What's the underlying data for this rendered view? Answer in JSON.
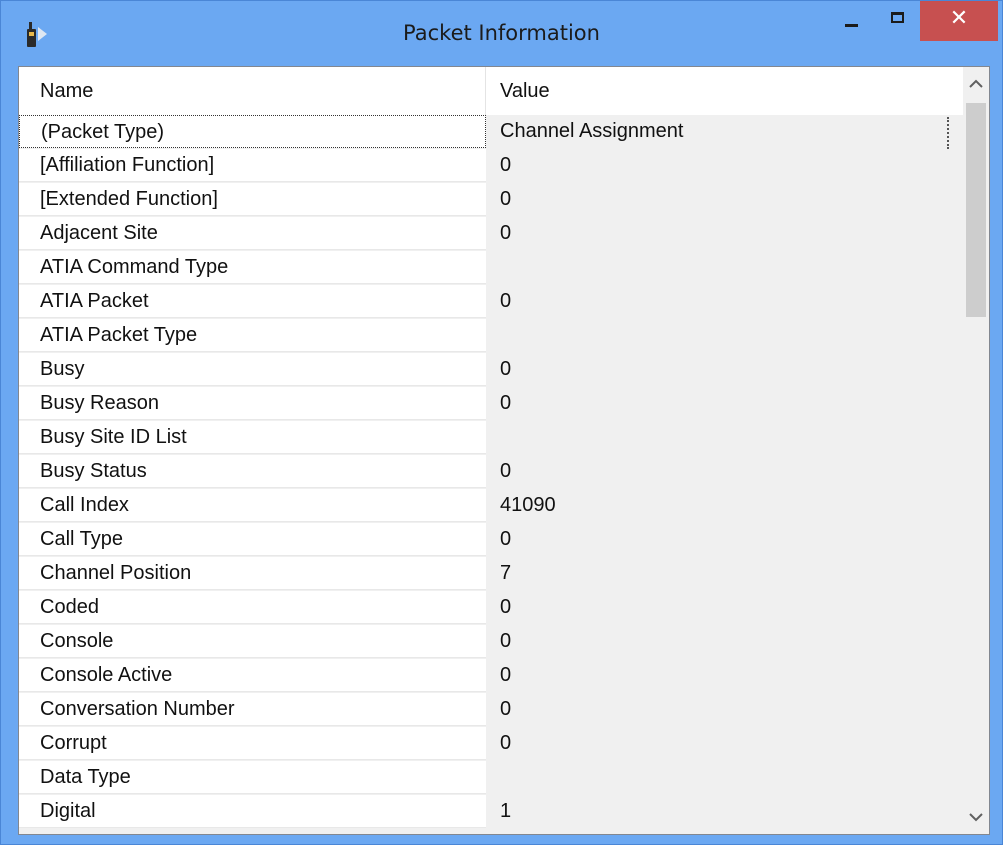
{
  "window": {
    "title": "Packet Information",
    "icon": "radio-icon",
    "controls": {
      "minimize": "minimize-icon",
      "maximize": "maximize-icon",
      "close_glyph": "✕"
    }
  },
  "table": {
    "columns": [
      "Name",
      "Value"
    ],
    "rows": [
      {
        "name": "(Packet Type)",
        "value": "Channel Assignment"
      },
      {
        "name": "[Affiliation Function]",
        "value": "0"
      },
      {
        "name": "[Extended Function]",
        "value": "0"
      },
      {
        "name": "Adjacent Site",
        "value": "0"
      },
      {
        "name": "ATIA Command Type",
        "value": ""
      },
      {
        "name": "ATIA Packet",
        "value": "0"
      },
      {
        "name": "ATIA Packet Type",
        "value": ""
      },
      {
        "name": "Busy",
        "value": "0"
      },
      {
        "name": "Busy Reason",
        "value": "0"
      },
      {
        "name": "Busy Site ID List",
        "value": ""
      },
      {
        "name": "Busy Status",
        "value": "0"
      },
      {
        "name": "Call Index",
        "value": "41090"
      },
      {
        "name": "Call Type",
        "value": "0"
      },
      {
        "name": "Channel Position",
        "value": "7"
      },
      {
        "name": "Coded",
        "value": "0"
      },
      {
        "name": "Console",
        "value": "0"
      },
      {
        "name": "Console Active",
        "value": "0"
      },
      {
        "name": "Conversation Number",
        "value": "0"
      },
      {
        "name": "Corrupt",
        "value": "0"
      },
      {
        "name": "Data Type",
        "value": ""
      },
      {
        "name": "Digital",
        "value": "1"
      }
    ]
  },
  "scrollbar": {
    "up_icon": "scroll-up-icon",
    "down_icon": "scroll-down-icon"
  }
}
